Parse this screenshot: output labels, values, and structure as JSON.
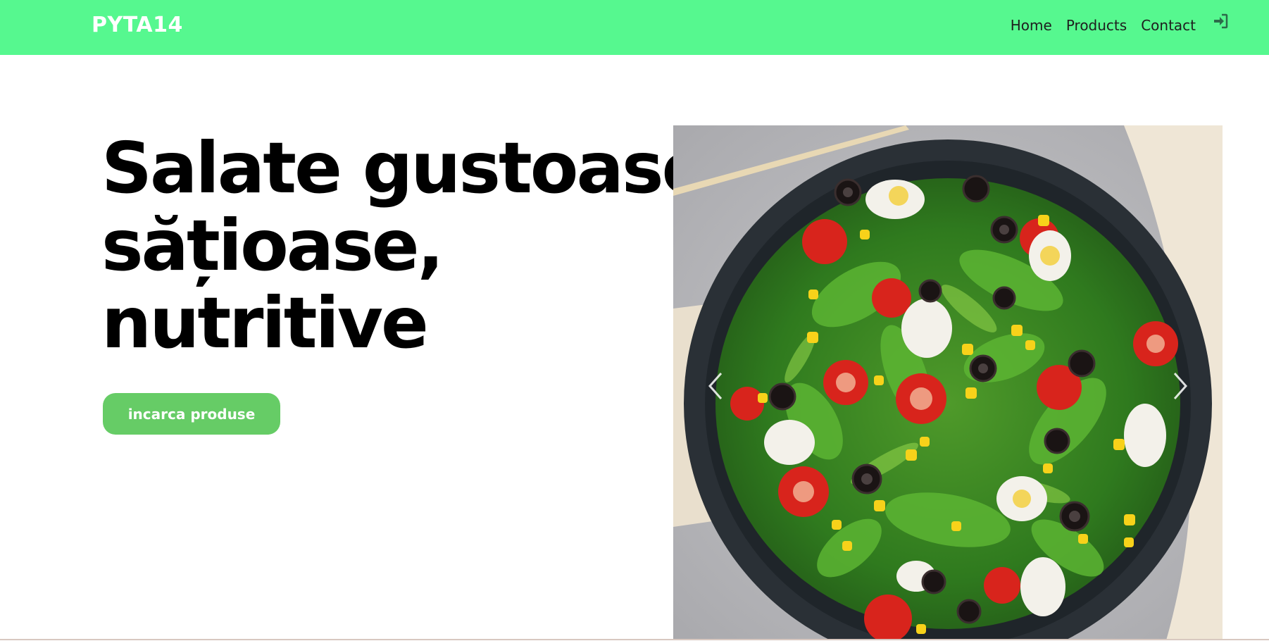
{
  "navbar": {
    "brand": "PYTA14",
    "links": [
      {
        "label": "Home"
      },
      {
        "label": "Products"
      },
      {
        "label": "Contact"
      }
    ],
    "login_icon": "sign-in-icon"
  },
  "hero": {
    "title_lines": [
      "Salate gustoase,",
      "sățioase,",
      "nutritive"
    ],
    "cta_label": "incarca produse"
  },
  "carousel": {
    "image": "salad-bowl-image",
    "prev_icon": "chevron-left-icon",
    "next_icon": "chevron-right-icon"
  },
  "colors": {
    "navbar_bg": "#56f88f",
    "brand_text": "#ffffff",
    "cta_bg": "#66cc66",
    "cta_text": "#ffffff"
  }
}
